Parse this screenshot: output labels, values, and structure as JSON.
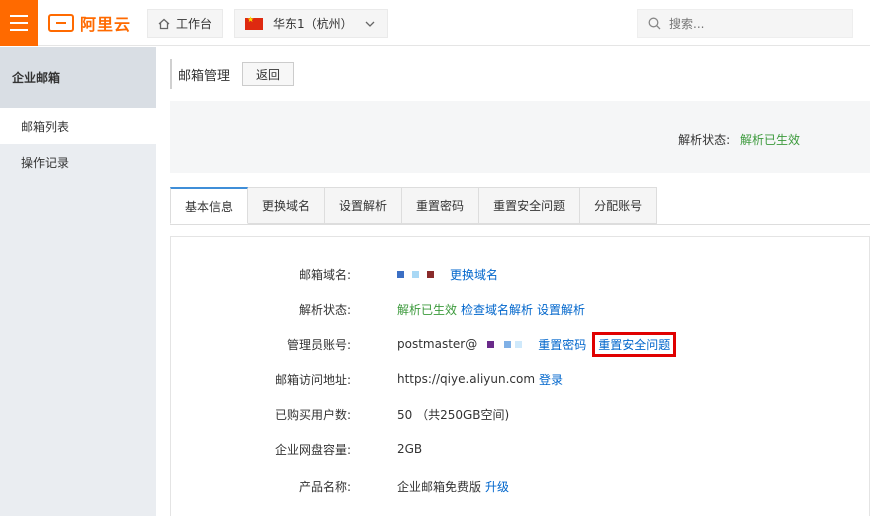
{
  "topbar": {
    "logo_text": "阿里云",
    "workbench_label": "工作台",
    "region_label": "华东1（杭州）",
    "search_placeholder": "搜索..."
  },
  "sidebar": {
    "title": "企业邮箱",
    "items": [
      {
        "label": "邮箱列表",
        "active": true
      },
      {
        "label": "操作记录",
        "active": false
      }
    ]
  },
  "main": {
    "page_title": "邮箱管理",
    "back_label": "返回",
    "status": {
      "label": "解析状态:",
      "value": "解析已生效"
    },
    "tabs": [
      "基本信息",
      "更换域名",
      "设置解析",
      "重置密码",
      "重置安全问题",
      "分配账号"
    ],
    "info": {
      "domain": {
        "label": "邮箱域名:",
        "action": "更换域名"
      },
      "dns": {
        "label": "解析状态:",
        "value": "解析已生效",
        "check": "检查域名解析",
        "set": "设置解析"
      },
      "admin": {
        "label": "管理员账号:",
        "value": "postmaster@",
        "reset_pwd": "重置密码",
        "reset_q": "重置安全问题"
      },
      "url": {
        "label": "邮箱访问地址:",
        "value": "https://qiye.aliyun.com",
        "login": "登录"
      },
      "users": {
        "label": "已购买用户数:",
        "value": "50 （共250GB空间)"
      },
      "disk": {
        "label": "企业网盘容量:",
        "value": "2GB"
      },
      "product": {
        "label": "产品名称:",
        "value": "企业邮箱免费版",
        "upgrade": "升级"
      }
    }
  },
  "colors": {
    "accent": "#ff6a00",
    "link": "#0066cc",
    "success": "#3c9a3c",
    "highlight": "#e00000"
  }
}
